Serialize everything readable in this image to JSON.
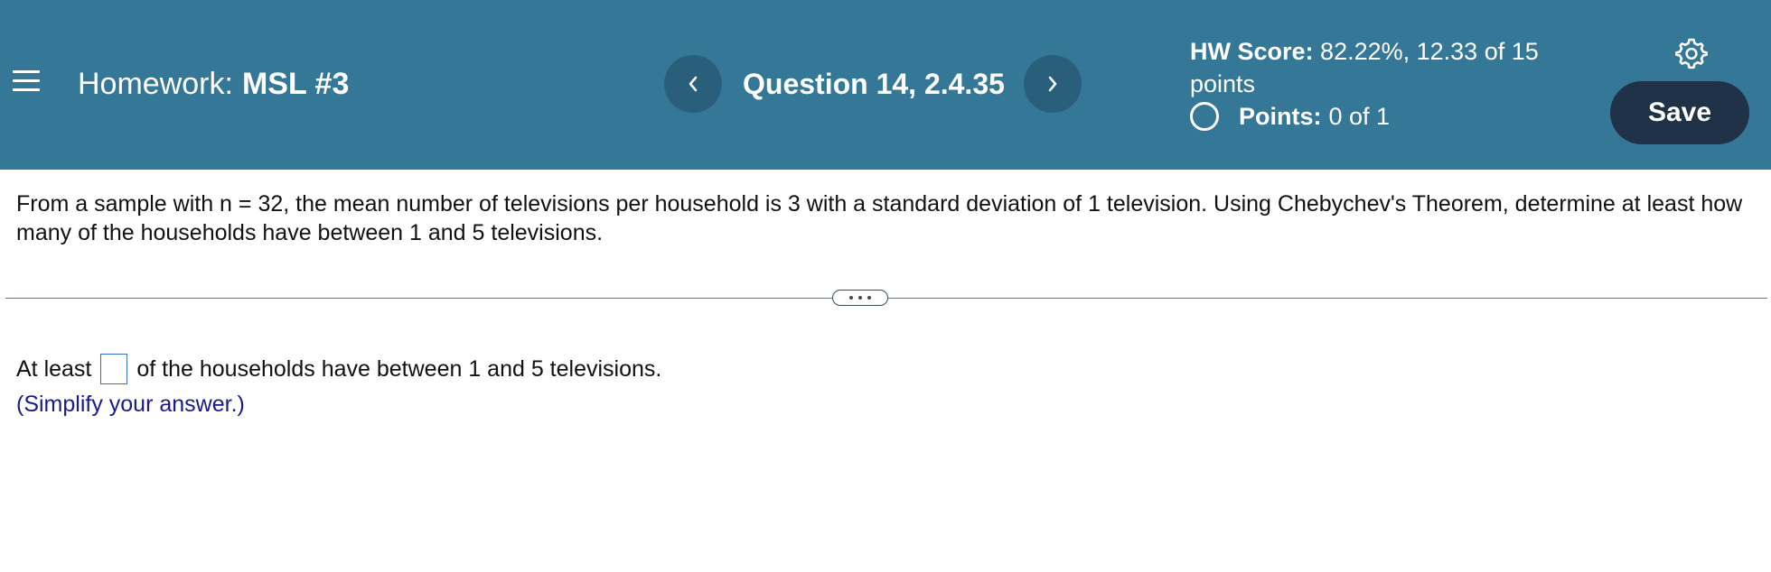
{
  "header": {
    "homework_prefix": "Homework:",
    "homework_name": "MSL #3",
    "question_label": "Question 14, 2.4.35",
    "hw_score_label": "HW Score:",
    "hw_score_value": "82.22%, 12.33 of 15 points",
    "points_label": "Points:",
    "points_value": "0 of 1",
    "save_label": "Save",
    "background_color": "#357797",
    "save_color": "#1f3247"
  },
  "icons": {
    "menu": "menu-icon",
    "prev": "chevron-left-icon",
    "next": "chevron-right-icon",
    "settings": "gear-icon",
    "status": "circle-icon",
    "expand": "more-horizontal-icon"
  },
  "question": {
    "text": "From a sample with n = 32, the mean number of televisions per household is 3 with a standard deviation of 1 television. Using Chebychev's Theorem, determine at least how many of the households have between 1 and 5 televisions."
  },
  "answer": {
    "prefix": "At least",
    "suffix": "of the households have between 1 and 5 televisions.",
    "input_value": "",
    "hint": "(Simplify your answer.)"
  }
}
